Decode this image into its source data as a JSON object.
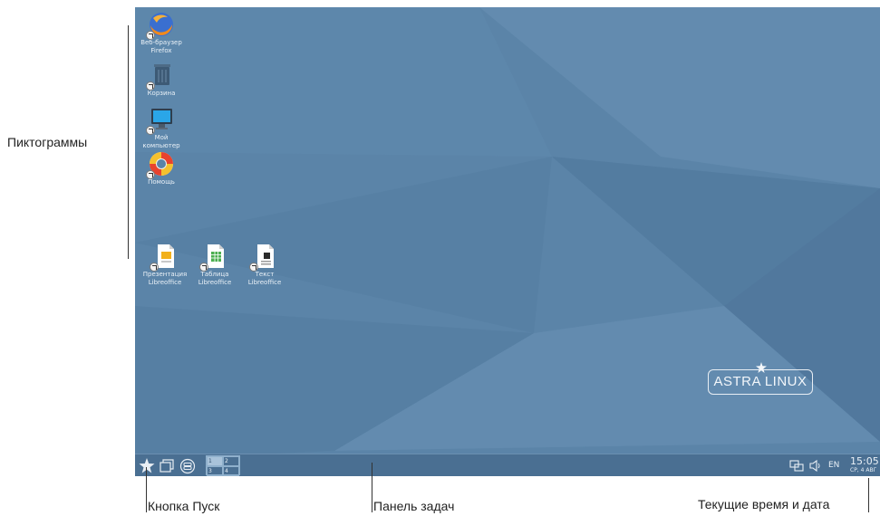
{
  "desktop": {
    "icons": [
      {
        "name": "firefox",
        "line1": "Веб-браузер",
        "line2": "Firefox"
      },
      {
        "name": "trash",
        "line1": "Корзина",
        "line2": ""
      },
      {
        "name": "computer",
        "line1": "Мой",
        "line2": "компьютер"
      },
      {
        "name": "help",
        "line1": "Помощь",
        "line2": ""
      },
      {
        "name": "impress",
        "line1": "Презентация",
        "line2": "Libreoffice"
      },
      {
        "name": "calc",
        "line1": "Таблица",
        "line2": "Libreoffice"
      },
      {
        "name": "writer",
        "line1": "Текст",
        "line2": "Libreoffice"
      }
    ],
    "logo": "ASTRA LINUX"
  },
  "taskbar": {
    "pager": [
      "1",
      "2",
      "3",
      "4"
    ],
    "lang": "EN",
    "time": "15:05",
    "date": "СР, 4 АВГ"
  },
  "callouts": {
    "icons": "Пиктограммы",
    "start": "Кнопка Пуск",
    "taskbar": "Панель задач",
    "clock": "Текущие время и дата"
  },
  "colors": {
    "desktop_bg": "#5b84a8",
    "taskbar_bg": "#4a6f92"
  }
}
